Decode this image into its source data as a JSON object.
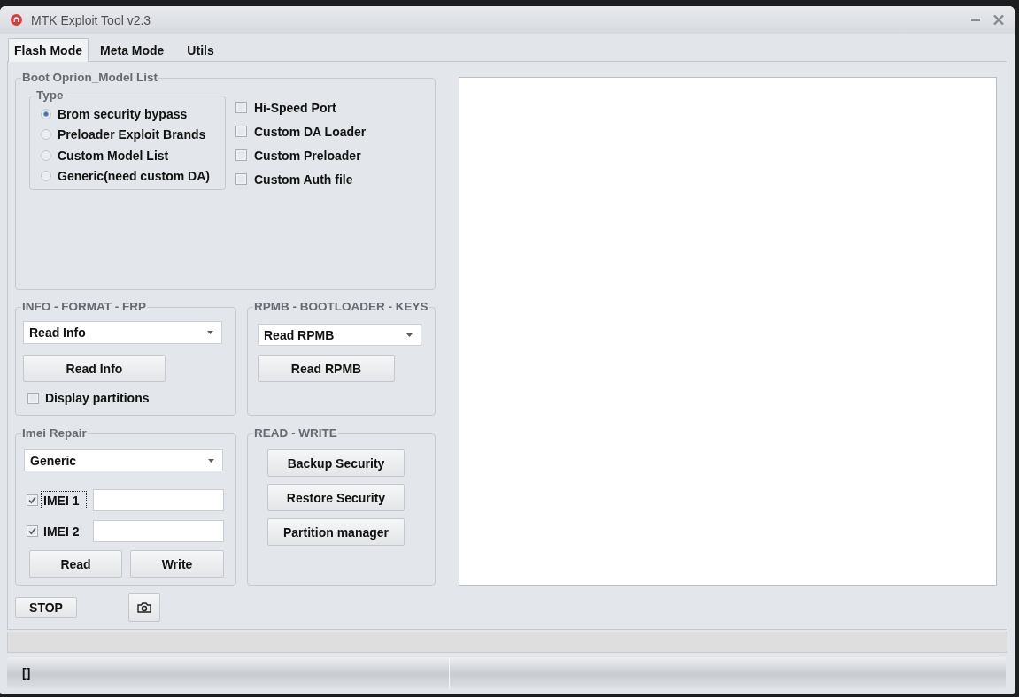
{
  "window": {
    "title": "MTK Exploit Tool v2.3"
  },
  "tabs": [
    {
      "label": "Flash Mode",
      "selected": true
    },
    {
      "label": "Meta Mode",
      "selected": false
    },
    {
      "label": "Utils",
      "selected": false
    }
  ],
  "boot_options": {
    "title": "Boot Oprion_Model List",
    "type_group": {
      "title": "Type",
      "options": [
        {
          "label": "Brom security bypass",
          "selected": true
        },
        {
          "label": "Preloader Exploit Brands",
          "selected": false
        },
        {
          "label": "Custom Model List",
          "selected": false
        },
        {
          "label": "Generic(need custom DA)",
          "selected": false
        }
      ]
    },
    "checkboxes": [
      {
        "label": "Hi-Speed Port",
        "checked": false
      },
      {
        "label": "Custom DA Loader",
        "checked": false
      },
      {
        "label": "Custom Preloader",
        "checked": false
      },
      {
        "label": "Custom Auth file",
        "checked": false
      }
    ]
  },
  "info_format_frp": {
    "title": "INFO - FORMAT - FRP",
    "dropdown": {
      "value": "Read Info"
    },
    "button": "Read Info",
    "checkbox": {
      "label": "Display partitions",
      "checked": false
    }
  },
  "rpmb_bootloader_keys": {
    "title": "RPMB - BOOTLOADER - KEYS",
    "dropdown": {
      "value": "Read RPMB"
    },
    "button": "Read RPMB"
  },
  "imei_repair": {
    "title": "Imei Repair",
    "dropdown": {
      "value": "Generic"
    },
    "fields": [
      {
        "label": "IMEI 1",
        "checked": true,
        "focused": true
      },
      {
        "label": "IMEI 2",
        "checked": true,
        "focused": false
      }
    ],
    "buttons": [
      "Read",
      "Write"
    ]
  },
  "read_write": {
    "title": "READ - WRITE",
    "buttons": [
      "Backup Security",
      "Restore Security",
      "Partition manager"
    ]
  },
  "stop_button": "STOP",
  "progress_bar": {
    "level": 0
  },
  "status_bar": {
    "text": "[]"
  }
}
